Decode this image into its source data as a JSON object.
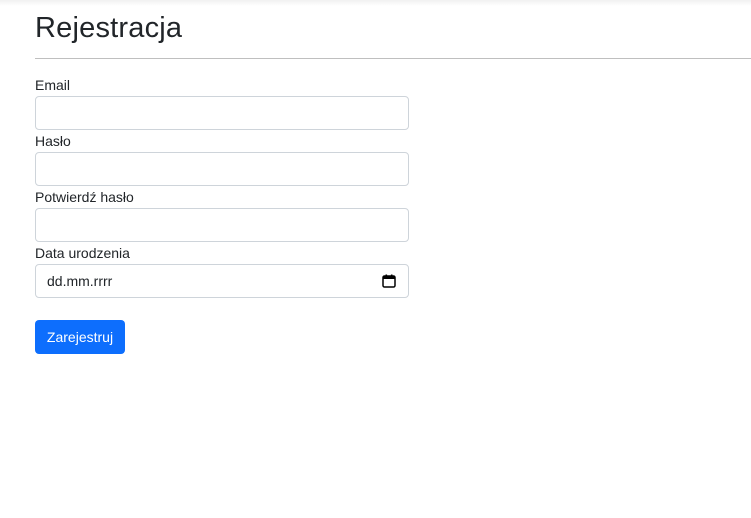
{
  "page": {
    "title": "Rejestracja"
  },
  "form": {
    "email": {
      "label": "Email",
      "value": ""
    },
    "password": {
      "label": "Hasło",
      "value": ""
    },
    "confirm_password": {
      "label": "Potwierdź hasło",
      "value": ""
    },
    "birth_date": {
      "label": "Data urodzenia",
      "placeholder": "dd.mm.rrrr",
      "icon": "calendar-icon"
    },
    "submit_label": "Zarejestruj"
  },
  "colors": {
    "primary": "#0d6efd",
    "input_border": "#ced4da",
    "text": "#212529"
  }
}
